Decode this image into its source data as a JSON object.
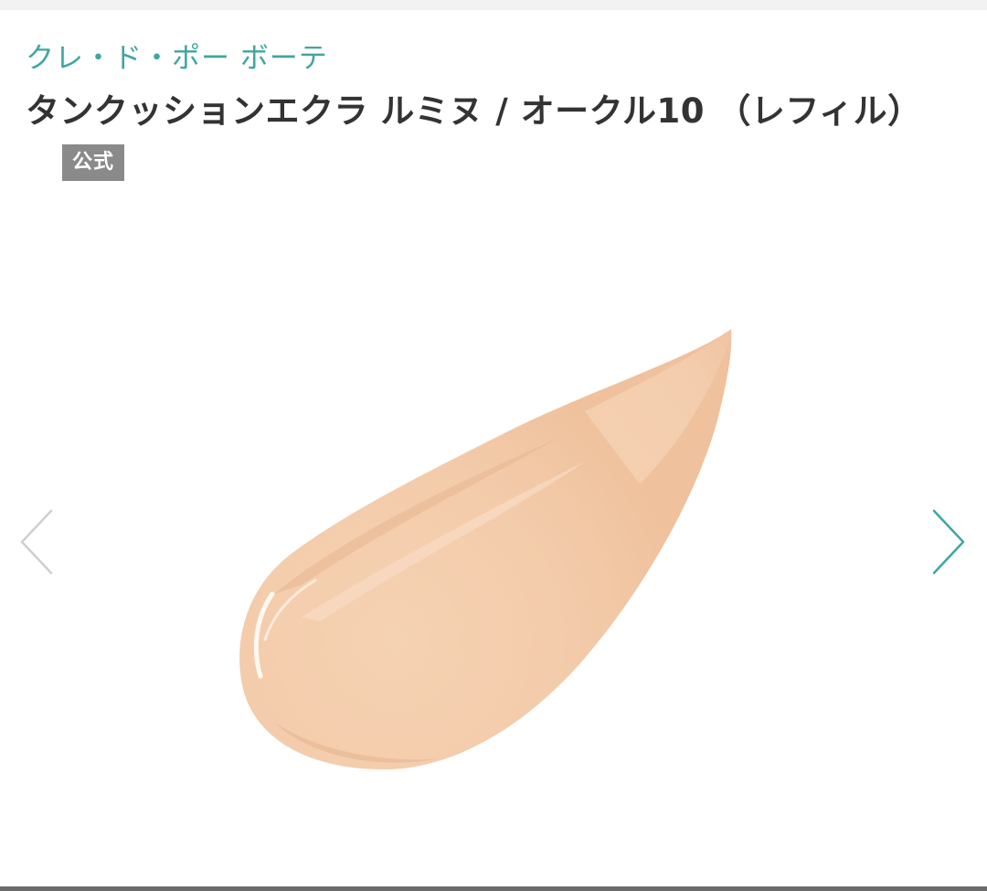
{
  "product": {
    "brand": "クレ・ド・ポー ボーテ",
    "title": "タンクッションエクラ ルミヌ / オークル10 （レフィル）",
    "badge": "公式"
  },
  "gallery": {
    "prev_icon": "chevron-left-icon",
    "next_icon": "chevron-right-icon",
    "image_subject": "foundation-swatch"
  },
  "colors": {
    "brand": "#3fa6a0",
    "title": "#333333",
    "badge_bg": "#8a8a8a",
    "arrow_prev": "#cfcfcf",
    "arrow_next": "#3fa6a0",
    "swatch": "#f4cfaf"
  }
}
